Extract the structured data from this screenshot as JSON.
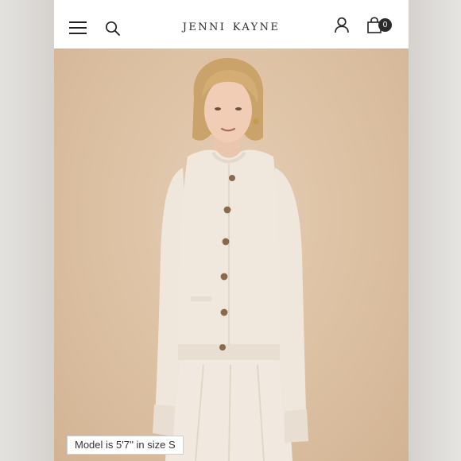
{
  "header": {
    "brand": "Jenni Kayne",
    "cart_count": "0"
  },
  "icons": {
    "menu": "hamburger-menu-icon",
    "search": "search-icon",
    "account": "account-icon",
    "cart": "shopping-bag-icon"
  },
  "hero": {
    "caption": "Model is 5'7'' in size S"
  },
  "colors": {
    "header_bg": "#ffffff",
    "hero_bg": "#dcc0a2",
    "sweater": "#efe7dc",
    "buttons": "#8a6a4a"
  }
}
